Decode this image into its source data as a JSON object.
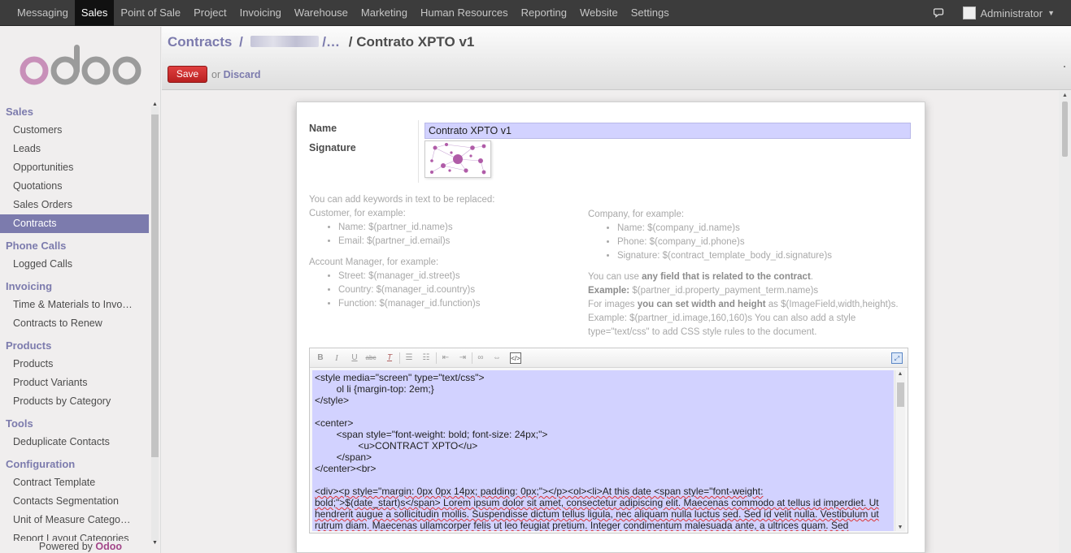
{
  "topbar": {
    "menu": [
      "Messaging",
      "Sales",
      "Point of Sale",
      "Project",
      "Invoicing",
      "Warehouse",
      "Marketing",
      "Human Resources",
      "Reporting",
      "Website",
      "Settings"
    ],
    "active_menu": "Sales",
    "user": "Administrator",
    "chat_icon": "chat-bubbles-icon",
    "avatar_icon": "user-avatar-icon"
  },
  "sidebar": {
    "logo": "odoo",
    "sections": [
      {
        "title": "Sales",
        "items": [
          "Customers",
          "Leads",
          "Opportunities",
          "Quotations",
          "Sales Orders",
          "Contracts"
        ]
      },
      {
        "title": "Phone Calls",
        "items": [
          "Logged Calls"
        ]
      },
      {
        "title": "Invoicing",
        "items": [
          "Time & Materials to Invo…",
          "Contracts to Renew"
        ]
      },
      {
        "title": "Products",
        "items": [
          "Products",
          "Product Variants",
          "Products by Category"
        ]
      },
      {
        "title": "Tools",
        "items": [
          "Deduplicate Contacts"
        ]
      },
      {
        "title": "Configuration",
        "items": [
          "Contract Template",
          "Contacts Segmentation",
          "Unit of Measure Catego…",
          "Report Layout Categories"
        ]
      }
    ],
    "active_item": "Contracts",
    "powered_by": "Powered by",
    "powered_brand": "Odoo"
  },
  "header": {
    "breadcrumb_root": "Contracts",
    "breadcrumb_sep": "/",
    "breadcrumb_mid_ellipsis": "/…",
    "breadcrumb_current": "/ Contrato XPTO v1",
    "save_label": "Save",
    "or_label": "or",
    "discard_label": "Discard"
  },
  "form": {
    "name_label": "Name",
    "name_value": "Contrato XPTO v1",
    "signature_label": "Signature",
    "help_intro": "You can add keywords in text to be replaced:",
    "customer_title": "Customer, for example:",
    "customer_items": [
      "Name: $(partner_id.name)s",
      "Email: $(partner_id.email)s"
    ],
    "manager_title": "Account Manager, for example:",
    "manager_items": [
      "Street: $(manager_id.street)s",
      "Country: $(manager_id.country)s",
      "Function: $(manager_id.function)s"
    ],
    "company_title": "Company, for example:",
    "company_items": [
      "Name: $(company_id.name)s",
      "Phone: $(company_id.phone)s",
      "Signature: $(contract_template_body_id.signature)s"
    ],
    "any_field_pre": "You can use",
    "any_field_bold": "any field that is related to the contract",
    "any_field_post": ".",
    "example_bold": "Example:",
    "example_text": "$(partner_id.property_payment_term.name)s",
    "images_pre": "For images",
    "images_bold": "you can set width and height",
    "images_post": "as $(ImageField,width,height)s.",
    "images_example": "Example: $(partner_id.image,160,160)s You can also add a style",
    "style_text": "type=\"text/css\" to add CSS style rules to the document."
  },
  "editor": {
    "toolbar": [
      "bold-icon",
      "italic-icon",
      "underline-icon",
      "strikethrough-icon",
      "remove-format-icon",
      "bullet-list-icon",
      "numbered-list-icon",
      "outdent-icon",
      "indent-icon",
      "link-icon",
      "unlink-icon",
      "source-icon",
      "fullscreen-icon"
    ],
    "lines": [
      "<style media=\"screen\" type=\"text/css\">",
      "        ol li {margin-top: 2em;}",
      "</style>",
      "",
      "<center>",
      "        <span style=\"font-weight: bold; font-size: 24px;\">",
      "                <u>CONTRACT XPTO</u>",
      "        </span>",
      "</center><br>",
      ""
    ],
    "paragraph": "<div><p style=\"margin: 0px 0px 14px; padding: 0px;\"></p><ol><li>At this date <span style=\"font-weight: bold;\">$(date_start)s</span> Lorem ipsum dolor sit amet, consectetur adipiscing elit. Maecenas commodo at tellus id imperdiet. Ut hendrerit augue a sollicitudin mollis. Suspendisse dictum tellus ligula, nec aliquam nulla luctus sed. Sed id velit nulla. Vestibulum ut rutrum diam. Maecenas ullamcorper felis ut leo feugiat pretium. Integer condimentum malesuada ante, a ultrices quam. Sed ullamcorper quam ut sem varius ullamcorper. Nulla et commodo urna. Nam sit amet ornare erat, ut mattis lectus. Suspendisse vitae"
  },
  "colors": {
    "brand_purple": "#7c7bad",
    "save_red": "#c82a2a",
    "input_bg": "#d2d2ff",
    "topbar_bg": "#3c3c3c"
  }
}
